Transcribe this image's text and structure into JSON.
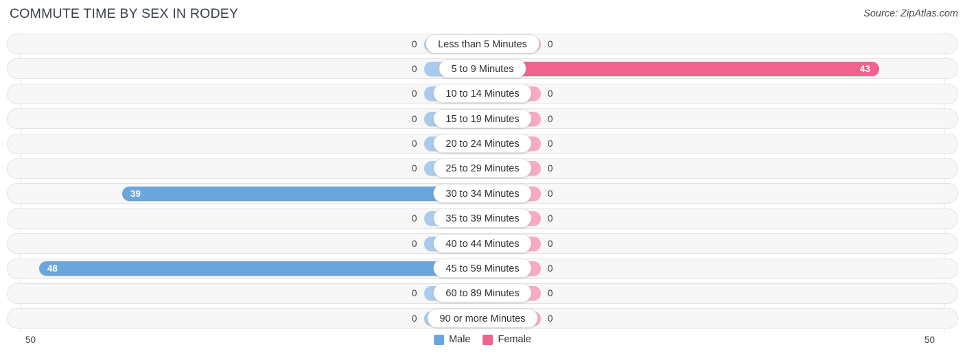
{
  "header": {
    "title": "COMMUTE TIME BY SEX IN RODEY",
    "source": "Source: ZipAtlas.com"
  },
  "axis": {
    "left_max_label": "50",
    "right_max_label": "50"
  },
  "legend": {
    "male_label": "Male",
    "female_label": "Female",
    "male_color": "#6aa6dc",
    "female_color": "#f2628f"
  },
  "colors": {
    "male_zero": "#a9cbec",
    "male_value": "#6aa6dc",
    "female_zero": "#f7a9c6",
    "female_value": "#f2628f",
    "track": "#f7f7f7",
    "grid": "#d9d9d9"
  },
  "chart_data": {
    "type": "bar",
    "title": "COMMUTE TIME BY SEX IN RODEY",
    "orientation": "horizontal-diverging",
    "xlabel": "",
    "ylabel": "",
    "axis_max": 50,
    "categories": [
      "Less than 5 Minutes",
      "5 to 9 Minutes",
      "10 to 14 Minutes",
      "15 to 19 Minutes",
      "20 to 24 Minutes",
      "25 to 29 Minutes",
      "30 to 34 Minutes",
      "35 to 39 Minutes",
      "40 to 44 Minutes",
      "45 to 59 Minutes",
      "60 to 89 Minutes",
      "90 or more Minutes"
    ],
    "series": [
      {
        "name": "Male",
        "values": [
          0,
          0,
          0,
          0,
          0,
          0,
          39,
          0,
          0,
          48,
          0,
          0
        ],
        "labels": [
          "0",
          "0",
          "0",
          "0",
          "0",
          "0",
          "39",
          "0",
          "0",
          "48",
          "0",
          "0"
        ]
      },
      {
        "name": "Female",
        "values": [
          0,
          43,
          0,
          0,
          0,
          0,
          0,
          0,
          0,
          0,
          0,
          0
        ],
        "labels": [
          "0",
          "43",
          "0",
          "0",
          "0",
          "0",
          "0",
          "0",
          "0",
          "0",
          "0",
          "0"
        ]
      }
    ]
  }
}
